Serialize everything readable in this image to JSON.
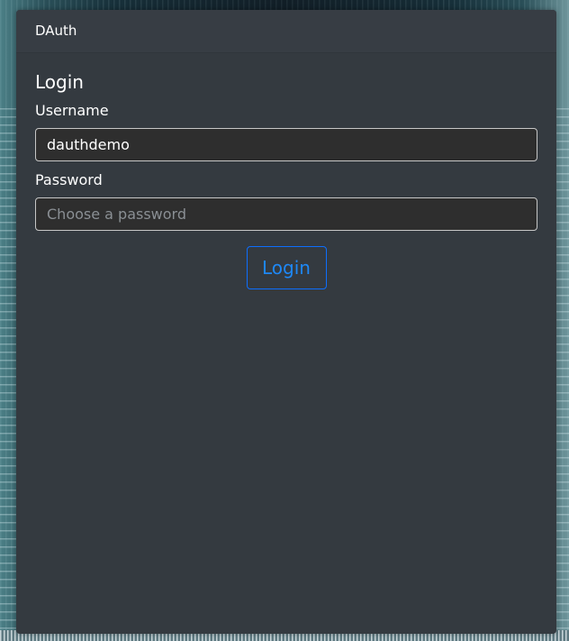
{
  "header": {
    "app_name": "DAuth"
  },
  "login_form": {
    "title": "Login",
    "username": {
      "label": "Username",
      "value": "dauthdemo"
    },
    "password": {
      "label": "Password",
      "placeholder": "Choose a password",
      "value": ""
    },
    "submit_label": "Login"
  },
  "colors": {
    "card_background": "#343a40",
    "accent": "#0d6efd",
    "input_background": "#2e2e2e",
    "text": "#ffffff"
  }
}
